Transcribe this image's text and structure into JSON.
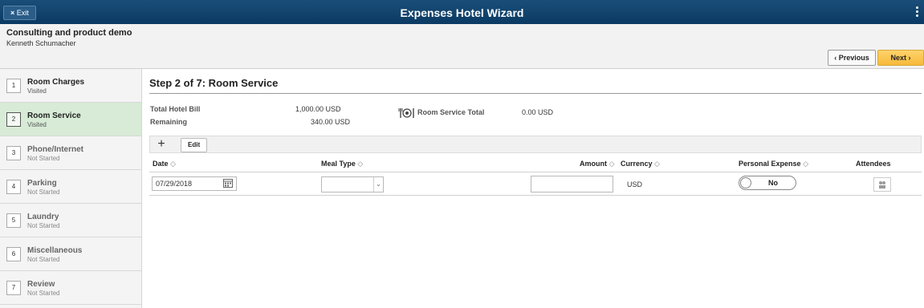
{
  "header": {
    "exit_label": "Exit",
    "exit_icon": "close-icon",
    "title": "Expenses Hotel Wizard",
    "menu_icon": "kebab-menu-icon"
  },
  "context": {
    "organization": "Consulting and product demo",
    "user_name": "Kenneth Schumacher"
  },
  "nav": {
    "previous_label": "Previous",
    "next_label": "Next"
  },
  "steps": [
    {
      "number": "1",
      "label": "Room Charges",
      "status": "Visited"
    },
    {
      "number": "2",
      "label": "Room Service",
      "status": "Visited"
    },
    {
      "number": "3",
      "label": "Phone/Internet",
      "status": "Not Started"
    },
    {
      "number": "4",
      "label": "Parking",
      "status": "Not Started"
    },
    {
      "number": "5",
      "label": "Laundry",
      "status": "Not Started"
    },
    {
      "number": "6",
      "label": "Miscellaneous",
      "status": "Not Started"
    },
    {
      "number": "7",
      "label": "Review",
      "status": "Not Started"
    }
  ],
  "main": {
    "step_title": "Step 2 of 7: Room Service",
    "summary": {
      "total_label": "Total Hotel Bill",
      "total_value": "1,000.00 USD",
      "remaining_label": "Remaining",
      "remaining_value": "340.00 USD",
      "rs_total_label": "Room Service Total",
      "rs_total_value": "0.00 USD"
    },
    "toolbar": {
      "add_symbol": "+",
      "edit_label": "Edit"
    },
    "columns": {
      "date": "Date",
      "meal_type": "Meal Type",
      "amount": "Amount",
      "currency": "Currency",
      "personal_expense": "Personal Expense",
      "attendees": "Attendees"
    },
    "row": {
      "date": "07/29/2018",
      "meal_type": "",
      "amount": "",
      "currency": "USD",
      "personal_expense": "No"
    }
  }
}
